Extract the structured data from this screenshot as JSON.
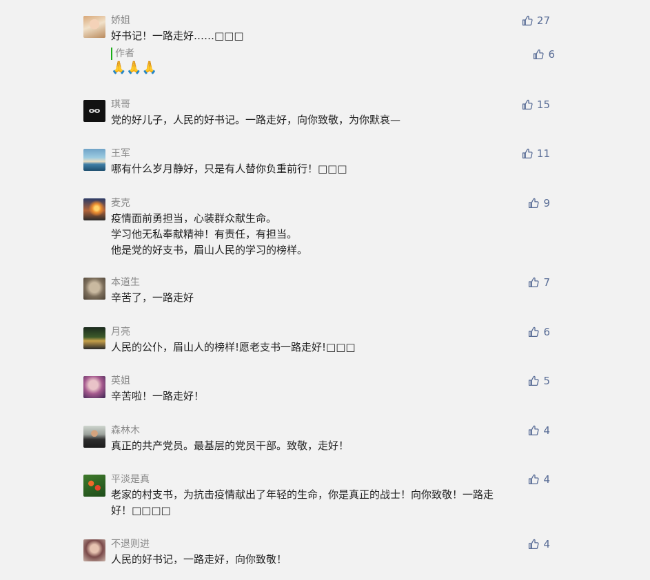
{
  "comments": [
    {
      "name": "娇姐",
      "text": [
        "好书记！一路走好……□□□"
      ],
      "likes": "27",
      "reply": {
        "author_label": "作者",
        "text": "🙏🙏🙏",
        "likes": "6"
      }
    },
    {
      "name": "琪哥",
      "text": [
        "党的好儿子，人民的好书记。一路走好，向你致敬，为你默哀—"
      ],
      "likes": "15"
    },
    {
      "name": "王军",
      "text": [
        "哪有什么岁月静好，只是有人替你负重前行！□□□"
      ],
      "likes": "11"
    },
    {
      "name": "麦克",
      "text": [
        "疫情面前勇担当，心装群众献生命。",
        "学习他无私奉献精神！有责任，有担当。",
        "他是党的好支书，眉山人民的学习的榜样。"
      ],
      "likes": "9"
    },
    {
      "name": "本道生",
      "text": [
        "辛苦了，一路走好"
      ],
      "likes": "7"
    },
    {
      "name": "月亮",
      "text": [
        "人民的公仆，眉山人的榜样!愿老支书一路走好!□□□"
      ],
      "likes": "6"
    },
    {
      "name": "英姐",
      "text": [
        "辛苦啦！一路走好！"
      ],
      "likes": "5"
    },
    {
      "name": "森林木",
      "text": [
        "真正的共产党员。最基层的党员干部。致敬，走好！"
      ],
      "likes": "4"
    },
    {
      "name": "平淡是真",
      "text": [
        "老家的村支书，为抗击疫情献出了年轻的生命，你是真正的战士！向你致敬！一路走",
        "好！□□□□"
      ],
      "likes": "4"
    },
    {
      "name": "不退则进",
      "text": [
        "人民的好书记，一路走好，向你致敬！"
      ],
      "likes": "4"
    }
  ]
}
